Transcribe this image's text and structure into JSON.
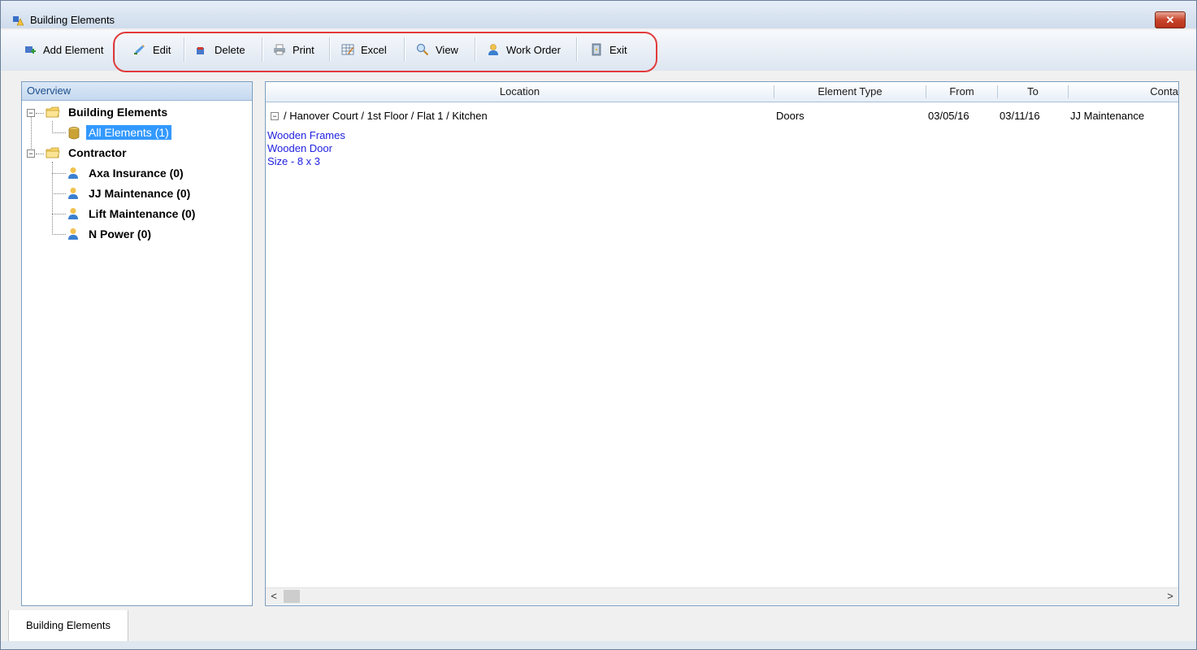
{
  "window": {
    "title": "Building Elements",
    "close_label": "✕"
  },
  "toolbar": {
    "items": [
      {
        "label": "Add Element",
        "icon": "add-element-icon"
      },
      {
        "label": "Edit",
        "icon": "edit-pencil-icon"
      },
      {
        "label": "Delete",
        "icon": "delete-icon"
      },
      {
        "label": "Print",
        "icon": "printer-icon"
      },
      {
        "label": "Excel",
        "icon": "excel-icon"
      },
      {
        "label": "View",
        "icon": "magnifier-icon"
      },
      {
        "label": "Work Order",
        "icon": "person-icon"
      },
      {
        "label": "Exit",
        "icon": "exit-door-icon"
      }
    ]
  },
  "overview": {
    "header": "Overview",
    "tree": {
      "building_elements": {
        "label": "Building Elements",
        "expander": "−"
      },
      "all_elements": {
        "label": "All Elements (1)"
      },
      "contractor": {
        "label": "Contractor",
        "expander": "−"
      },
      "contractors": [
        {
          "label": "Axa Insurance (0)"
        },
        {
          "label": "JJ Maintenance (0)"
        },
        {
          "label": "Lift Maintenance (0)"
        },
        {
          "label": "N Power (0)"
        }
      ]
    }
  },
  "grid": {
    "columns": [
      "Location",
      "Element Type",
      "From",
      "To",
      "Conta"
    ],
    "row": {
      "expander": "−",
      "location": "/ Hanover Court / 1st Floor / Flat 1 / Kitchen",
      "element_type": "Doors",
      "from": "03/05/16",
      "to": "03/11/16",
      "contractor": "JJ Maintenance"
    },
    "details": [
      "Wooden  Frames",
      "Wooden Door",
      "Size - 8 x 3"
    ],
    "scroll_left": "<",
    "scroll_right": ">"
  },
  "tabs": [
    {
      "label": "Building Elements"
    }
  ],
  "colors": {
    "accent": "#3399ff",
    "highlight_outline": "#e23b3b",
    "detail_text": "#2020e0"
  }
}
